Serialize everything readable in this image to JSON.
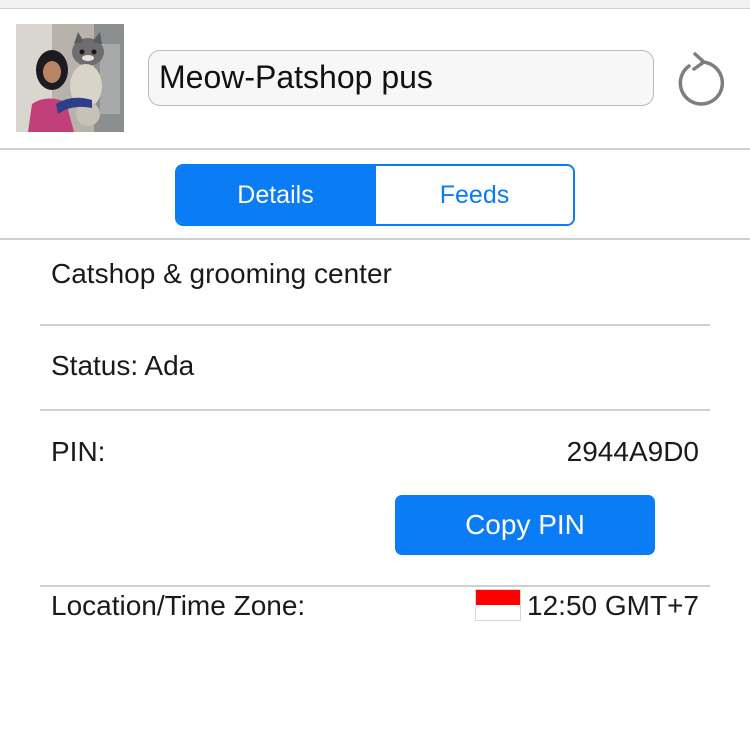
{
  "profile": {
    "name": "Meow-Patshop pus",
    "avatar_icon": "profile-photo"
  },
  "header": {
    "refresh_icon": "refresh-icon"
  },
  "tabs": [
    {
      "label": "Details",
      "active": true
    },
    {
      "label": "Feeds",
      "active": false
    }
  ],
  "details": {
    "description": "Catshop & grooming center",
    "status_label": "Status:",
    "status_value": "Ada",
    "pin_label": "PIN:",
    "pin_value": "2944A9D0",
    "copy_pin_label": "Copy PIN",
    "location_label": "Location/Time Zone:",
    "location_value": "12:50 GMT+7",
    "flag_icon": "indonesia-flag-icon"
  },
  "colors": {
    "accent": "#0a7cf5",
    "flag_red": "#ff0000",
    "flag_white": "#ffffff"
  }
}
